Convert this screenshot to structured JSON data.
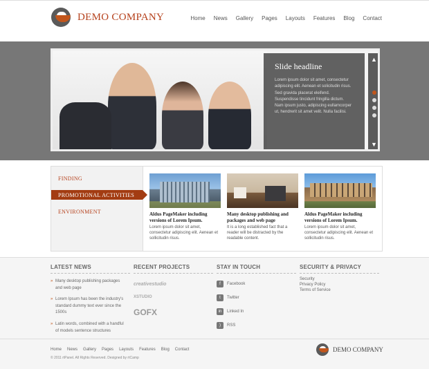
{
  "header": {
    "brand": "DEMO COMPANY",
    "nav": [
      "Home",
      "News",
      "Gallery",
      "Pages",
      "Layouts",
      "Features",
      "Blog",
      "Contact"
    ]
  },
  "slider": {
    "headline": "Slide headline",
    "text": "Lorem ipsum dolor sit amet, consectetur adipiscing elit. Aenean et solicitudin risus. Sed gravida placerat eleifend. Suspendisse tincidunt fringilla dictum. Nam ipsum justo, adipiscing eullamcorper ut, hendrerit sit amet velit. Nulla facilisi.",
    "up_icon": "chevron-up-icon",
    "down_icon": "chevron-down-icon"
  },
  "promo": {
    "tabs": [
      "FINDING",
      "PROMOTIONAL ACTIVITIES",
      "ENVIRONMENT"
    ],
    "cards": [
      {
        "title": "Aldus PageMaker including versions of Lorem Ipsum.",
        "text": "Lorem ipsum dolor sit amet, consectetur adipiscing elit. Aenean et sollicitudin risus."
      },
      {
        "title": "Many desktop publishing and packages and web page",
        "text": "It is a long established fact that a reader will be distracted by the readable content."
      },
      {
        "title": "Aldus PageMaker including versions of Lorem Ipsum.",
        "text": "Lorem ipsum dolor sit amet, consectetur adipiscing elit. Aenean et sollicitudin risus."
      }
    ]
  },
  "footer": {
    "latest_news": {
      "heading": "LATEST NEWS",
      "items": [
        "Many desktop publishing packages and web page",
        "Lorem Ipsum has been the industry's standard dummy text ever since the 1500s",
        "Latin words, combined with a handful of models sentence structures"
      ]
    },
    "recent_projects": {
      "heading": "RECENT PROJECTS",
      "logos": [
        "creativestudio",
        "XSTUDIO",
        "GOFX"
      ]
    },
    "stay_in_touch": {
      "heading": "STAY IN TOUCH",
      "links": [
        "Facebook",
        "Twitter",
        "Linked In",
        "RSS"
      ]
    },
    "security": {
      "heading": "SECURITY & PRIVACY",
      "links": [
        "Security",
        "Privacy Policy",
        "Terms of Service"
      ]
    },
    "nav": [
      "Home",
      "News",
      "Gallery",
      "Pages",
      "Layouts",
      "Features",
      "Blog",
      "Contact"
    ],
    "copyright": "© 2011 rtPanel. All Rights Reserved. Designed by rtCamp",
    "brand": "DEMO COMPANY"
  },
  "colors": {
    "accent": "#a33c12",
    "band": "#777777"
  }
}
